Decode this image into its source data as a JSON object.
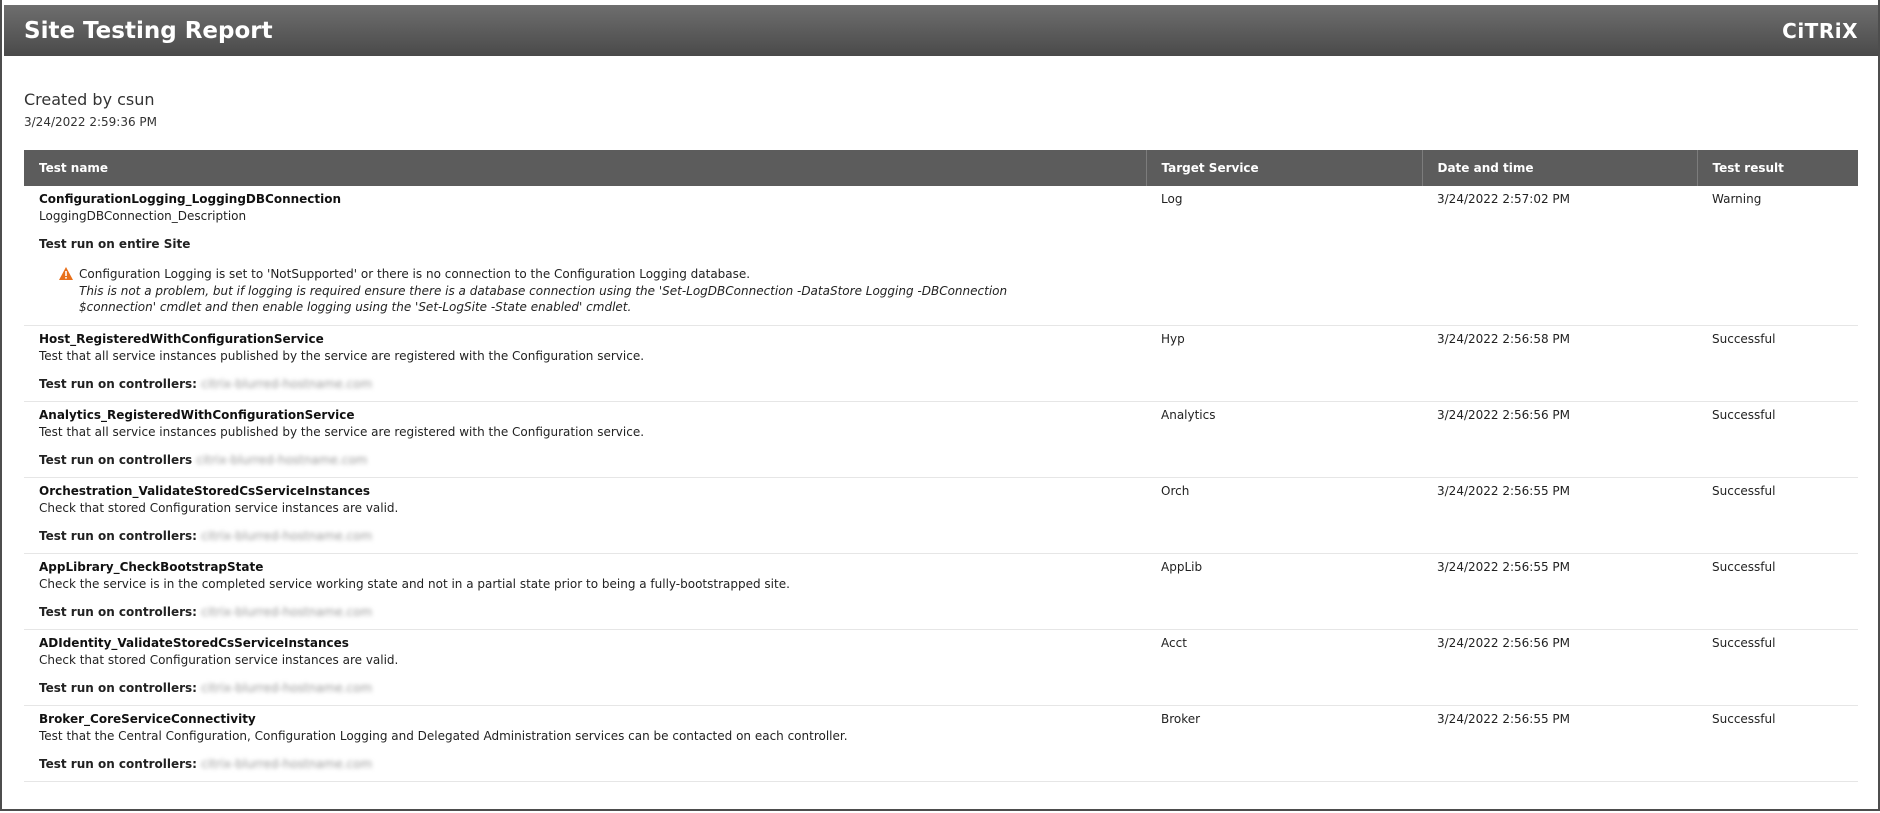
{
  "header": {
    "title": "Site Testing Report",
    "logo": "CiTRiX"
  },
  "meta": {
    "created_by": "Created by csun",
    "created_at": "3/24/2022 2:59:36 PM"
  },
  "table": {
    "columns": [
      "Test name",
      "Target Service",
      "Date and time",
      "Test result"
    ],
    "rows": [
      {
        "name": "ConfigurationLogging_LoggingDBConnection",
        "description": "LoggingDBConnection_Description",
        "run_on": "Test run on entire Site",
        "service": "Log",
        "datetime": "3/24/2022 2:57:02 PM",
        "result": "Warning",
        "warning": {
          "icon": "warning-icon",
          "message": "Configuration Logging is set to 'NotSupported' or there is no connection to the Configuration Logging database.",
          "note": "This is not a problem, but if logging is required ensure there is a database connection using the 'Set-LogDBConnection -DataStore Logging -DBConnection $connection' cmdlet and then enable logging using the 'Set-LogSite -State enabled' cmdlet."
        }
      },
      {
        "name": "Host_RegisteredWithConfigurationService",
        "description": "Test that all service instances published by the service are registered with the Configuration service.",
        "run_on": "Test run on controllers:",
        "host": "citrix-blurred-hostname.com",
        "service": "Hyp",
        "datetime": "3/24/2022 2:56:58 PM",
        "result": "Successful"
      },
      {
        "name": "Analytics_RegisteredWithConfigurationService",
        "description": "Test that all service instances published by the service are registered with the Configuration service.",
        "run_on": "Test run on controllers",
        "host": "citrix-blurred-hostname.com",
        "service": "Analytics",
        "datetime": "3/24/2022 2:56:56 PM",
        "result": "Successful"
      },
      {
        "name": "Orchestration_ValidateStoredCsServiceInstances",
        "description": "Check that stored Configuration service instances are valid.",
        "run_on": "Test run on controllers:",
        "host": "citrix-blurred-hostname.com",
        "service": "Orch",
        "datetime": "3/24/2022 2:56:55 PM",
        "result": "Successful"
      },
      {
        "name": "AppLibrary_CheckBootstrapState",
        "description": "Check the service is in the completed service working state and not in a partial state prior to being a fully-bootstrapped site.",
        "run_on": "Test run on controllers:",
        "host": "citrix-blurred-hostname.com",
        "service": "AppLib",
        "datetime": "3/24/2022 2:56:55 PM",
        "result": "Successful"
      },
      {
        "name": "ADIdentity_ValidateStoredCsServiceInstances",
        "description": "Check that stored Configuration service instances are valid.",
        "run_on": "Test run on controllers:",
        "host": "citrix-blurred-hostname.com",
        "service": "Acct",
        "datetime": "3/24/2022 2:56:56 PM",
        "result": "Successful"
      },
      {
        "name": "Broker_CoreServiceConnectivity",
        "description": "Test that the Central Configuration, Configuration Logging and Delegated Administration services can be contacted on each controller.",
        "run_on": "Test run on controllers:",
        "host": "citrix-blurred-hostname.com",
        "service": "Broker",
        "datetime": "3/24/2022 2:56:55 PM",
        "result": "Successful"
      }
    ]
  },
  "colors": {
    "header_bg": "#545454",
    "table_header_bg": "#5c5c5c",
    "warning": "#e8701a"
  }
}
